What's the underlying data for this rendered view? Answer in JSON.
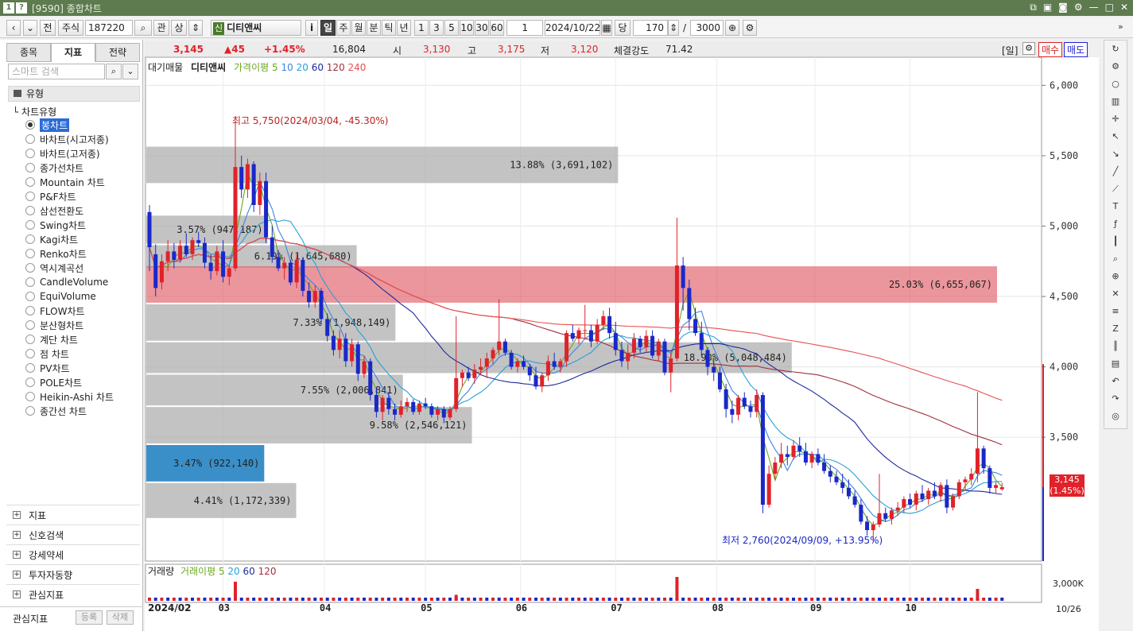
{
  "window": {
    "number_badge": "1",
    "help_badge": "?",
    "title": "[9590] 종합차트"
  },
  "toolbar": {
    "jeon": "전",
    "type": "주식",
    "code": "187220",
    "gwan": "관",
    "sang": "상",
    "stock_badge": "신",
    "stock_name": "디티앤씨",
    "info": "i",
    "periods": [
      "일",
      "주",
      "월",
      "분",
      "틱",
      "년"
    ],
    "intervals": [
      "1",
      "3",
      "5",
      "10",
      "30",
      "60"
    ],
    "count_select": "1",
    "date": "2024/10/22",
    "dang": "당",
    "display_count": "170",
    "slash": "/",
    "total_count": "3000"
  },
  "left_panel": {
    "tabs": [
      "종목",
      "지표",
      "전략"
    ],
    "search_placeholder": "스마트 검색",
    "tree_head": "유형",
    "tree_sub": "차트유형",
    "chart_types": [
      "봉차트",
      "바차트(시고저종)",
      "바차트(고저종)",
      "종가선차트",
      "Mountain 차트",
      "P&F차트",
      "삼선전환도",
      "Swing차트",
      "Kagi차트",
      "Renko차트",
      "역시계곡선",
      "CandleVolume",
      "EquiVolume",
      "FLOW차트",
      "분산형차트",
      "계단 차트",
      "점 차트",
      "PV차트",
      "POLE차트",
      "Heikin-Ashi 차트",
      "종간선 차트"
    ],
    "groups": [
      "지표",
      "신호검색",
      "강세약세",
      "투자자동향",
      "관심지표"
    ],
    "bottom_label": "관심지표",
    "register": "등록",
    "delete": "삭제"
  },
  "quote": {
    "price": "3,145",
    "change": "▲45",
    "change_pct": "+1.45%",
    "volume": "16,804",
    "open_label": "시",
    "open": "3,130",
    "high_label": "고",
    "high": "3,175",
    "low_label": "저",
    "low": "3,120",
    "strength_label": "체결강도",
    "strength": "71.42",
    "period_tag": "[일]",
    "buy": "매수",
    "sell": "매도"
  },
  "colors": {
    "up": "#e0222a",
    "down": "#1a28c8",
    "ma5": "#6aa820",
    "ma10": "#3c84e0",
    "ma20": "#2aa0d8",
    "ma60": "#1c2a9a",
    "ma120": "#a03040",
    "ma240": "#e85050"
  },
  "legend": {
    "price": {
      "header": "대기매물",
      "stock": "디티앤씨",
      "ma_label": "가격이평",
      "periods": [
        "5",
        "10",
        "20",
        "60",
        "120",
        "240"
      ]
    },
    "volume": {
      "header": "거래량",
      "ma_label": "거래이평",
      "periods": [
        "5",
        "20",
        "60",
        "120"
      ]
    }
  },
  "annotations": {
    "high": "최고 5,750(2024/03/04, -45.30%)",
    "low": "최저 2,760(2024/09/09, +13.95%)"
  },
  "last_price_tag": {
    "price": "3,145",
    "pct": "(1.45%)"
  },
  "volume_axis_label": "3,000K",
  "end_date_label": "10/26",
  "start_date_label": "2024/02",
  "chart_data": {
    "type": "candlestick",
    "y_ticks": [
      "6,000",
      "5,500",
      "5,000",
      "4,500",
      "4,000",
      "3,500"
    ],
    "ylim": [
      2620,
      6200
    ],
    "x_months": [
      "03",
      "04",
      "05",
      "06",
      "07",
      "08",
      "09",
      "10"
    ],
    "volume_profile": [
      {
        "low": 5300,
        "high": 5570,
        "label": "13.88% (3,691,102)"
      },
      {
        "low": 4870,
        "high": 5080,
        "label": "3.57% (947,187)"
      },
      {
        "low": 4700,
        "high": 4870,
        "label": "6.19% (1,645,680)"
      },
      {
        "low": 4450,
        "high": 4720,
        "label": "25.03% (6,655,067)",
        "highlight": true
      },
      {
        "low": 4180,
        "high": 4450,
        "label": "7.33% (1,948,149)"
      },
      {
        "low": 3950,
        "high": 4180,
        "label": "18.99% (5,048,484)"
      },
      {
        "low": 3720,
        "high": 3950,
        "label": "7.55% (2,006,841)"
      },
      {
        "low": 3450,
        "high": 3720,
        "label": "9.58% (2,546,121)"
      },
      {
        "low": 3180,
        "high": 3450,
        "label": "3.47% (922,140)",
        "current": true
      },
      {
        "low": 2920,
        "high": 3180,
        "label": "4.41% (1,172,339)"
      }
    ],
    "candles": [
      [
        0,
        5100,
        5150,
        4680,
        4850
      ],
      [
        2,
        4800,
        4870,
        4500,
        4560
      ],
      [
        4,
        4600,
        4800,
        4550,
        4750
      ],
      [
        6,
        4750,
        4900,
        4680,
        4820
      ],
      [
        8,
        4820,
        4880,
        4700,
        4760
      ],
      [
        10,
        4760,
        4900,
        4740,
        4860
      ],
      [
        12,
        4860,
        4950,
        4780,
        4800
      ],
      [
        14,
        4800,
        4920,
        4760,
        4900
      ],
      [
        16,
        4900,
        4960,
        4850,
        4880
      ],
      [
        18,
        4880,
        4920,
        4700,
        4740
      ],
      [
        20,
        4740,
        4800,
        4620,
        4680
      ],
      [
        22,
        4680,
        4860,
        4650,
        4820
      ],
      [
        24,
        4820,
        4900,
        4600,
        4640
      ],
      [
        26,
        4640,
        4720,
        4580,
        4700
      ],
      [
        28,
        4700,
        5750,
        4680,
        5420
      ],
      [
        30,
        5420,
        5500,
        5200,
        5260
      ],
      [
        32,
        5260,
        5480,
        5200,
        5440
      ],
      [
        34,
        5440,
        5460,
        5100,
        5150
      ],
      [
        36,
        5150,
        5380,
        5080,
        5320
      ],
      [
        38,
        5320,
        5380,
        4880,
        4920
      ],
      [
        40,
        4920,
        5000,
        4740,
        4780
      ],
      [
        42,
        4780,
        4830,
        4680,
        4700
      ],
      [
        44,
        4700,
        4780,
        4620,
        4740
      ],
      [
        46,
        4740,
        4760,
        4580,
        4600
      ],
      [
        48,
        4600,
        4800,
        4560,
        4760
      ],
      [
        50,
        4760,
        4780,
        4500,
        4540
      ],
      [
        52,
        4540,
        4600,
        4420,
        4460
      ],
      [
        54,
        4460,
        4580,
        4420,
        4540
      ],
      [
        56,
        4540,
        4560,
        4300,
        4340
      ],
      [
        58,
        4340,
        4380,
        4180,
        4220
      ],
      [
        60,
        4220,
        4260,
        4080,
        4120
      ],
      [
        62,
        4120,
        4260,
        4060,
        4200
      ],
      [
        64,
        4200,
        4240,
        4000,
        4040
      ],
      [
        66,
        4040,
        4200,
        4000,
        4160
      ],
      [
        68,
        4160,
        4180,
        3900,
        3950
      ],
      [
        70,
        3950,
        4080,
        3920,
        4040
      ],
      [
        72,
        4040,
        4060,
        3760,
        3800
      ],
      [
        74,
        3800,
        3850,
        3640,
        3680
      ],
      [
        76,
        3680,
        3800,
        3620,
        3780
      ],
      [
        78,
        3780,
        3820,
        3660,
        3700
      ],
      [
        80,
        3700,
        3740,
        3620,
        3660
      ],
      [
        82,
        3660,
        3760,
        3640,
        3720
      ],
      [
        84,
        3720,
        3780,
        3680,
        3750
      ],
      [
        86,
        3750,
        3770,
        3660,
        3680
      ],
      [
        88,
        3680,
        3760,
        3660,
        3740
      ],
      [
        90,
        3740,
        3780,
        3700,
        3720
      ],
      [
        92,
        3720,
        3740,
        3640,
        3660
      ],
      [
        94,
        3660,
        3720,
        3620,
        3700
      ],
      [
        96,
        3700,
        3720,
        3600,
        3640
      ],
      [
        98,
        3640,
        3720,
        3620,
        3700
      ],
      [
        100,
        3700,
        4360,
        3680,
        3920
      ],
      [
        102,
        3920,
        3980,
        3860,
        3960
      ],
      [
        104,
        3960,
        4000,
        3900,
        3920
      ],
      [
        106,
        3920,
        4020,
        3880,
        3980
      ],
      [
        108,
        3980,
        4060,
        3940,
        4000
      ],
      [
        110,
        4000,
        4100,
        3920,
        4060
      ],
      [
        112,
        4060,
        4140,
        4020,
        4120
      ],
      [
        114,
        4120,
        4480,
        4080,
        4180
      ],
      [
        116,
        4180,
        4200,
        4080,
        4100
      ],
      [
        118,
        4100,
        4120,
        3980,
        4000
      ],
      [
        120,
        4000,
        4060,
        3960,
        4040
      ],
      [
        122,
        4040,
        4080,
        3980,
        4000
      ],
      [
        124,
        4000,
        4020,
        3900,
        3940
      ],
      [
        126,
        3940,
        4000,
        3840,
        3860
      ],
      [
        128,
        3860,
        3960,
        3820,
        3940
      ],
      [
        130,
        3940,
        4080,
        3900,
        4040
      ],
      [
        132,
        4040,
        4100,
        3980,
        4000
      ],
      [
        134,
        4000,
        4060,
        3960,
        4040
      ],
      [
        136,
        4040,
        4260,
        4000,
        4240
      ],
      [
        138,
        4240,
        4300,
        4180,
        4200
      ],
      [
        140,
        4200,
        4280,
        4160,
        4260
      ],
      [
        142,
        4260,
        4440,
        4200,
        4260
      ],
      [
        144,
        4260,
        4300,
        4140,
        4180
      ],
      [
        146,
        4180,
        4340,
        4160,
        4300
      ],
      [
        148,
        4300,
        4400,
        4260,
        4360
      ],
      [
        150,
        4360,
        4420,
        4200,
        4240
      ],
      [
        152,
        4240,
        4320,
        4080,
        4120
      ],
      [
        154,
        4120,
        4180,
        4000,
        4040
      ],
      [
        156,
        4040,
        4160,
        3980,
        4100
      ],
      [
        158,
        4100,
        4240,
        4060,
        4200
      ],
      [
        160,
        4200,
        4220,
        4100,
        4140
      ],
      [
        162,
        4140,
        4260,
        4100,
        4220
      ],
      [
        164,
        4220,
        4260,
        4060,
        4080
      ],
      [
        166,
        4080,
        4200,
        4040,
        4180
      ],
      [
        168,
        4180,
        4200,
        3940,
        3960
      ],
      [
        170,
        3960,
        4100,
        3820,
        4060
      ],
      [
        172,
        4060,
        5060,
        4040,
        4720
      ],
      [
        174,
        4720,
        4780,
        4400,
        4560
      ],
      [
        176,
        4560,
        4620,
        4260,
        4340
      ],
      [
        178,
        4340,
        4420,
        4220,
        4240
      ],
      [
        180,
        4240,
        4320,
        4080,
        4120
      ],
      [
        182,
        4120,
        4140,
        3940,
        4000
      ],
      [
        184,
        4000,
        4060,
        3900,
        3960
      ],
      [
        186,
        3960,
        4000,
        3820,
        3840
      ],
      [
        188,
        3840,
        3880,
        3640,
        3700
      ],
      [
        190,
        3700,
        3760,
        3600,
        3660
      ],
      [
        192,
        3660,
        3800,
        3620,
        3780
      ],
      [
        194,
        3780,
        3820,
        3700,
        3720
      ],
      [
        196,
        3720,
        3760,
        3640,
        3680
      ],
      [
        198,
        3680,
        3840,
        3640,
        3800
      ],
      [
        200,
        3800,
        3820,
        2960,
        3020
      ],
      [
        202,
        3020,
        3300,
        3000,
        3240
      ],
      [
        204,
        3240,
        3360,
        3200,
        3320
      ],
      [
        206,
        3320,
        3460,
        3280,
        3380
      ],
      [
        208,
        3380,
        3440,
        3300,
        3360
      ],
      [
        210,
        3360,
        3480,
        3340,
        3440
      ],
      [
        212,
        3440,
        3500,
        3360,
        3400
      ],
      [
        214,
        3400,
        3460,
        3300,
        3320
      ],
      [
        216,
        3320,
        3400,
        3280,
        3380
      ],
      [
        218,
        3380,
        3420,
        3300,
        3320
      ],
      [
        220,
        3320,
        3380,
        3240,
        3260
      ],
      [
        222,
        3260,
        3300,
        3180,
        3220
      ],
      [
        224,
        3220,
        3260,
        3160,
        3180
      ],
      [
        226,
        3180,
        3240,
        3100,
        3140
      ],
      [
        228,
        3140,
        3200,
        3060,
        3080
      ],
      [
        230,
        3080,
        3120,
        3000,
        3020
      ],
      [
        232,
        3020,
        3060,
        2880,
        2900
      ],
      [
        234,
        2900,
        2940,
        2800,
        2840
      ],
      [
        236,
        2840,
        2900,
        2760,
        2880
      ],
      [
        238,
        2880,
        3240,
        2860,
        2960
      ],
      [
        240,
        2960,
        3000,
        2900,
        2920
      ],
      [
        242,
        2920,
        3000,
        2880,
        2980
      ],
      [
        244,
        2980,
        3040,
        2940,
        3000
      ],
      [
        246,
        3000,
        3080,
        2960,
        3060
      ],
      [
        248,
        3060,
        3100,
        3000,
        3020
      ],
      [
        250,
        3020,
        3120,
        2980,
        3100
      ],
      [
        252,
        3100,
        3160,
        3040,
        3060
      ],
      [
        254,
        3060,
        3140,
        3020,
        3120
      ],
      [
        256,
        3120,
        3180,
        3060,
        3080
      ],
      [
        258,
        3080,
        3180,
        3040,
        3160
      ],
      [
        260,
        3160,
        3200,
        2960,
        3000
      ],
      [
        262,
        3000,
        3100,
        2980,
        3080
      ],
      [
        264,
        3080,
        3200,
        3060,
        3180
      ],
      [
        266,
        3180,
        3220,
        3120,
        3200
      ],
      [
        268,
        3200,
        3280,
        3160,
        3240
      ],
      [
        270,
        3240,
        3820,
        3180,
        3420
      ],
      [
        272,
        3420,
        3440,
        3240,
        3280
      ],
      [
        274,
        3280,
        3300,
        3100,
        3140
      ],
      [
        276,
        3140,
        3180,
        3100,
        3160
      ],
      [
        278,
        3130,
        3175,
        3120,
        3145
      ]
    ],
    "volume_spikes": [
      {
        "t": 28,
        "v": 0.8
      },
      {
        "t": 100,
        "v": 0.25
      },
      {
        "t": 172,
        "v": 1.0
      },
      {
        "t": 270,
        "v": 0.5
      }
    ]
  }
}
